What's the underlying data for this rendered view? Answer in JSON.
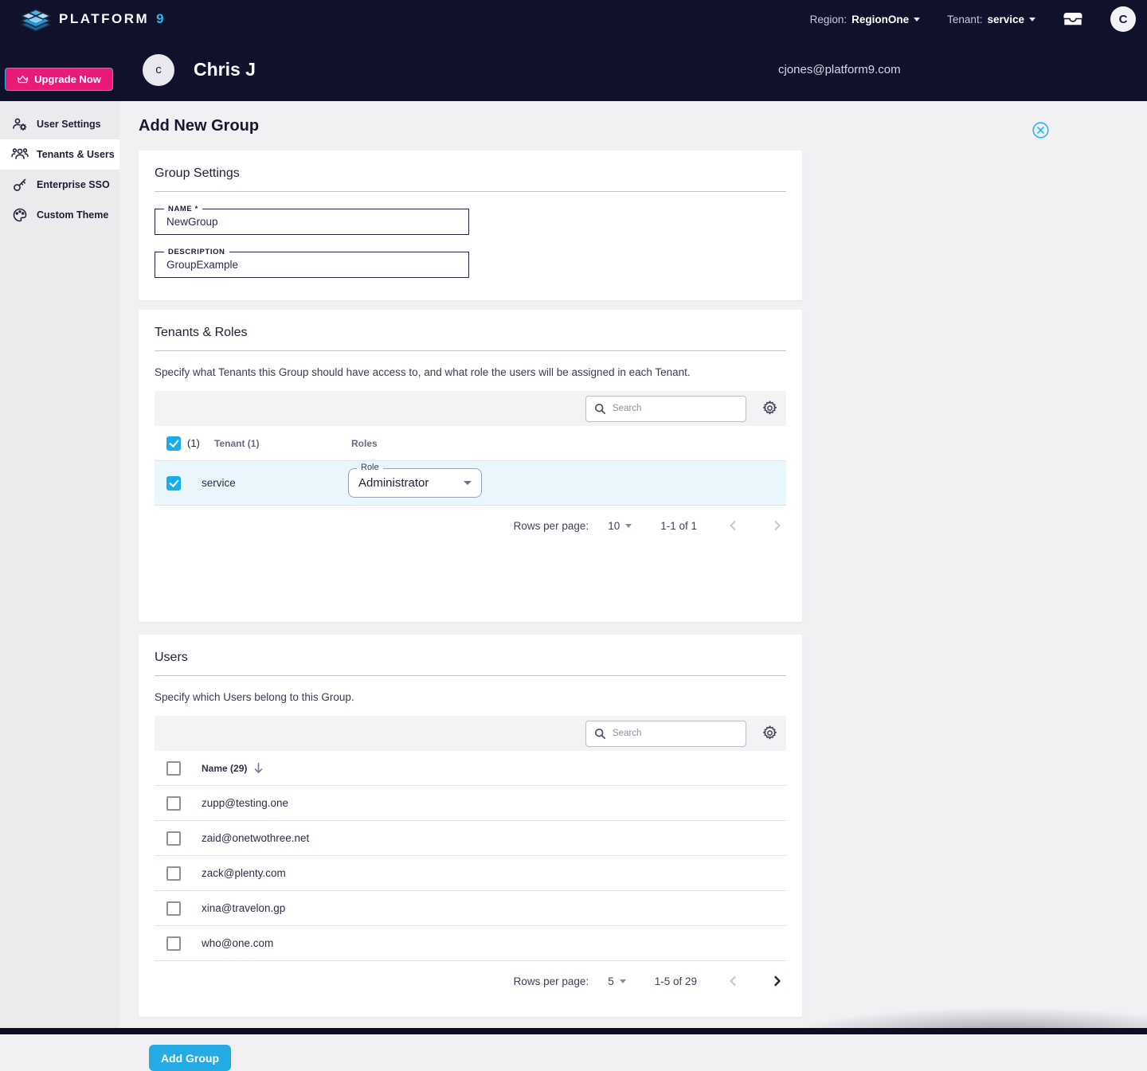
{
  "topbar": {
    "brand_name": "PLATFORM",
    "brand_nine": "9",
    "region_label": "Region:",
    "region_value": "RegionOne",
    "tenant_label": "Tenant:",
    "tenant_value": "service",
    "avatar_letter": "C"
  },
  "userbar": {
    "avatar_letter": "c",
    "title": "Chris J",
    "email": "cjones@platform9.com"
  },
  "sidebar": {
    "upgrade_label": "Upgrade Now",
    "items": [
      {
        "label": "User Settings",
        "icon": "user-gear-icon"
      },
      {
        "label": "Tenants & Users",
        "icon": "users-group-icon"
      },
      {
        "label": "Enterprise SSO",
        "icon": "key-icon"
      },
      {
        "label": "Custom Theme",
        "icon": "palette-icon"
      }
    ]
  },
  "page": {
    "title": "Add New Group"
  },
  "group_settings": {
    "title": "Group Settings",
    "fields": [
      {
        "label": "NAME *",
        "value": "NewGroup"
      },
      {
        "label": "DESCRIPTION",
        "value": "GroupExample"
      }
    ]
  },
  "tenants_roles": {
    "title": "Tenants & Roles",
    "description": "Specify what Tenants this Group should have access to, and what role the users will be assigned in each Tenant.",
    "search_placeholder": "Search",
    "header_count": "(1)",
    "tenant_col": "Tenant (1)",
    "roles_col": "Roles",
    "row": {
      "tenant": "service",
      "role_label": "Role",
      "role_value": "Administrator"
    },
    "pagination": {
      "rows_label": "Rows per page:",
      "rows_value": "10",
      "range": "1-1 of 1"
    }
  },
  "users": {
    "title": "Users",
    "description": "Specify which Users belong to this Group.",
    "search_placeholder": "Search",
    "name_col": "Name (29)",
    "rows": [
      "zupp@testing.one",
      "zaid@onetwothree.net",
      "zack@plenty.com",
      "xina@travelon.gp",
      "who@one.com"
    ],
    "pagination": {
      "rows_label": "Rows per page:",
      "rows_value": "5",
      "range": "1-5 of 29"
    }
  },
  "actions": {
    "add_group_label": "Add Group"
  },
  "colors": {
    "header_bg": "#10122c",
    "accent_cyan": "#25abe4",
    "brand_pink": "#ea1b78",
    "selected_row": "#e9f7fd",
    "sidebar_bg": "#ebebee",
    "main_bg": "#f1f1f4"
  }
}
